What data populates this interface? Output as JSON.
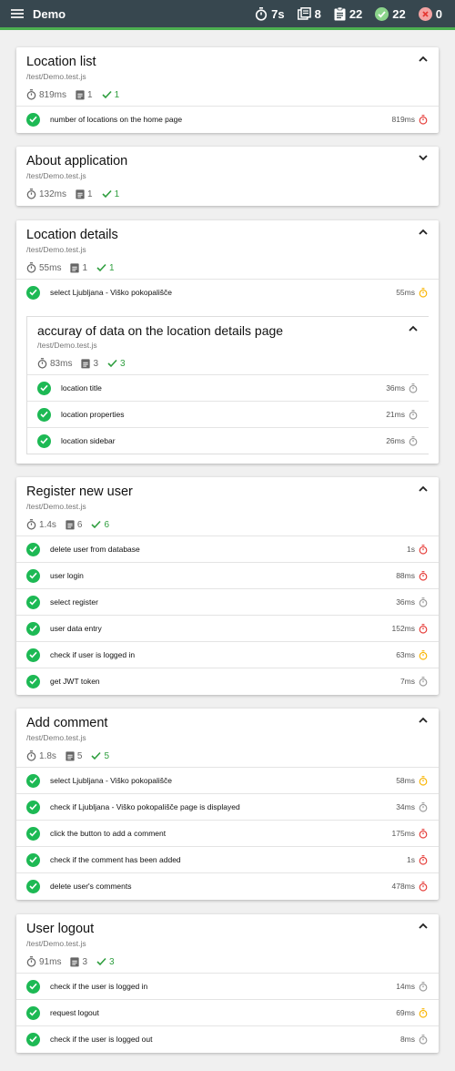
{
  "app": {
    "title": "Demo",
    "stats": {
      "duration": "7s",
      "suites": "8",
      "tests": "22",
      "passed": "22",
      "failed": "0"
    }
  },
  "colors": {
    "header": "#37474f",
    "accent": "#4caf50",
    "pass": "#1db954",
    "slow_red": "#e53935",
    "slow_yellow": "#f9b400",
    "ok_gray": "#999999"
  },
  "suites": [
    {
      "title": "Location list",
      "file": "/test/Demo.test.js",
      "duration": "819ms",
      "tests": "1",
      "passed": "1",
      "expanded": true,
      "items": [
        {
          "name": "number of locations on the home page",
          "duration": "819ms",
          "speed": "slow"
        }
      ]
    },
    {
      "title": "About application",
      "file": "/test/Demo.test.js",
      "duration": "132ms",
      "tests": "1",
      "passed": "1",
      "expanded": false,
      "items": []
    },
    {
      "title": "Location details",
      "file": "/test/Demo.test.js",
      "duration": "55ms",
      "tests": "1",
      "passed": "1",
      "expanded": true,
      "items": [
        {
          "name": "select Ljubljana - Viško pokopališče",
          "duration": "55ms",
          "speed": "medium"
        }
      ],
      "nested": {
        "title": "accuray of data on the location details page",
        "file": "/test/Demo.test.js",
        "duration": "83ms",
        "tests": "3",
        "passed": "3",
        "items": [
          {
            "name": "location title",
            "duration": "36ms",
            "speed": "fast"
          },
          {
            "name": "location properties",
            "duration": "21ms",
            "speed": "fast"
          },
          {
            "name": "location sidebar",
            "duration": "26ms",
            "speed": "fast"
          }
        ]
      }
    },
    {
      "title": "Register new user",
      "file": "/test/Demo.test.js",
      "duration": "1.4s",
      "tests": "6",
      "passed": "6",
      "expanded": true,
      "items": [
        {
          "name": "delete user from database",
          "duration": "1s",
          "speed": "slow"
        },
        {
          "name": "user login",
          "duration": "88ms",
          "speed": "slow"
        },
        {
          "name": "select register",
          "duration": "36ms",
          "speed": "fast"
        },
        {
          "name": "user data entry",
          "duration": "152ms",
          "speed": "slow"
        },
        {
          "name": "check if user is logged in",
          "duration": "63ms",
          "speed": "medium"
        },
        {
          "name": "get JWT token",
          "duration": "7ms",
          "speed": "fast"
        }
      ]
    },
    {
      "title": "Add comment",
      "file": "/test/Demo.test.js",
      "duration": "1.8s",
      "tests": "5",
      "passed": "5",
      "expanded": true,
      "items": [
        {
          "name": "select Ljubljana - Viško pokopališče",
          "duration": "58ms",
          "speed": "medium"
        },
        {
          "name": "check if Ljubljana - Viško pokopališče page is displayed",
          "duration": "34ms",
          "speed": "fast"
        },
        {
          "name": "click the button to add a comment",
          "duration": "175ms",
          "speed": "slow"
        },
        {
          "name": "check if the comment has been added",
          "duration": "1s",
          "speed": "slow"
        },
        {
          "name": "delete user's comments",
          "duration": "478ms",
          "speed": "slow"
        }
      ]
    },
    {
      "title": "User logout",
      "file": "/test/Demo.test.js",
      "duration": "91ms",
      "tests": "3",
      "passed": "3",
      "expanded": true,
      "items": [
        {
          "name": "check if the user is logged in",
          "duration": "14ms",
          "speed": "fast"
        },
        {
          "name": "request logout",
          "duration": "69ms",
          "speed": "medium"
        },
        {
          "name": "check if the user is logged out",
          "duration": "8ms",
          "speed": "fast"
        }
      ]
    }
  ]
}
